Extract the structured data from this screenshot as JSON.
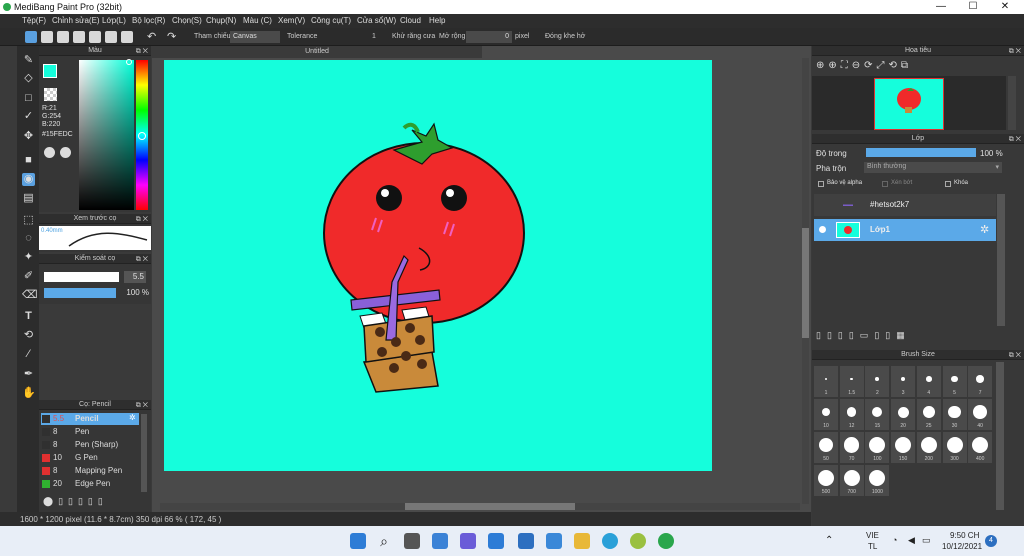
{
  "window": {
    "title": "MediBang Paint Pro (32bit)",
    "minimize": "—",
    "maximize": "☐",
    "close": "✕"
  },
  "menu": [
    "Tệp(F)",
    "Chỉnh sửa(E)",
    "Lớp(L)",
    "Bộ lọc(R)",
    "Chọn(S)",
    "Chụp(N)",
    "Màu (C)",
    "Xem(V)",
    "Công cụ(T)",
    "Cửa sổ(W)",
    "Cloud",
    "Help"
  ],
  "toolbar": {
    "reference_label": "Tham chiếu",
    "reference_value": "Canvas",
    "tolerance_label": "Tolerance",
    "tolerance_value": "1",
    "antialias_label": "Khử răng cưa",
    "expand_label": "Mở rộng",
    "expand_value": "0",
    "expand_unit": "pixel",
    "close_gap_label": "Đóng khe hở"
  },
  "color_panel": {
    "title": "Màu",
    "r": "R:21",
    "g": "G:254",
    "b": "B:220",
    "hex": "#15FEDC",
    "current_color": "#15fedc"
  },
  "preview_panel": {
    "title": "Xem trước cọ",
    "size": "0.40mm"
  },
  "brush_control": {
    "title": "Kiểm soát cọ",
    "size_value": "5.5",
    "opacity_value": "100 %"
  },
  "brush_panel": {
    "title": "Cọ: Pencil",
    "items": [
      {
        "size": "5.5",
        "name": "Pencil",
        "color": "#303030",
        "selected": true
      },
      {
        "size": "8",
        "name": "Pen",
        "color": "#303030"
      },
      {
        "size": "8",
        "name": "Pen (Sharp)",
        "color": "#303030"
      },
      {
        "size": "10",
        "name": "G Pen",
        "color": "#e03030"
      },
      {
        "size": "8",
        "name": "Mapping Pen",
        "color": "#e03030"
      },
      {
        "size": "20",
        "name": "Edge Pen",
        "color": "#30b030"
      }
    ]
  },
  "canvas": {
    "tab": "Untitled",
    "bg": "#15fedc"
  },
  "status": {
    "text": "1600 * 1200 pixel   (11.6 * 8.7cm)   350 dpi   66 %   ( 172, 45 )"
  },
  "navigator": {
    "title": "Hoa tiêu"
  },
  "layer_panel": {
    "title": "Lớp",
    "opacity_label": "Độ trong",
    "opacity_value": "100 %",
    "blend_label": "Pha trộn",
    "blend_value": "Bình thường",
    "protect_alpha": "Bảo vệ alpha",
    "clipping": "Xén bớt",
    "lock": "Khóa",
    "layers": [
      {
        "name": "#hetsot2k7"
      },
      {
        "name": "Lớp1",
        "selected": true
      }
    ]
  },
  "brush_size_panel": {
    "title": "Brush Size",
    "sizes": [
      "1",
      "1.5",
      "2",
      "3",
      "4",
      "5",
      "7",
      "10",
      "12",
      "15",
      "20",
      "25",
      "30",
      "40",
      "50",
      "70",
      "100",
      "150",
      "200",
      "300",
      "400",
      "500",
      "700",
      "1000"
    ]
  },
  "taskbar": {
    "lang_top": "VIE",
    "lang_bottom": "TL",
    "time": "9:50 CH",
    "date": "10/12/2021",
    "notif": "4"
  }
}
